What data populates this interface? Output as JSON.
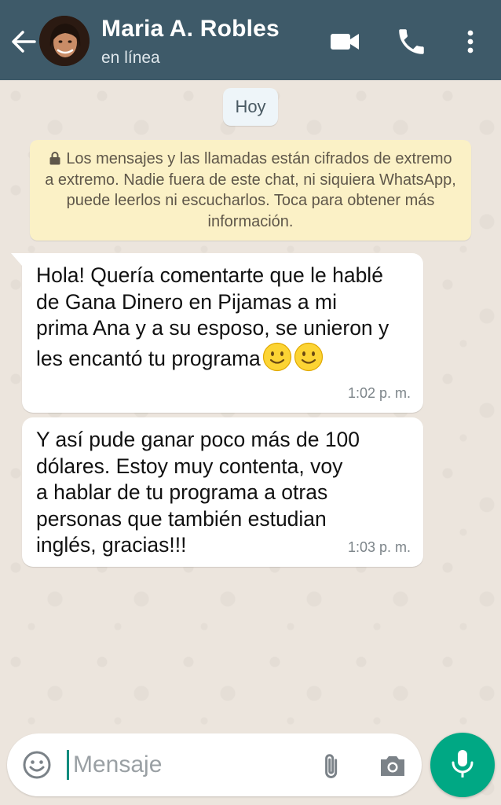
{
  "header": {
    "contact_name": "Maria A. Robles",
    "status": "en línea",
    "icons": {
      "back": "arrow-left-icon",
      "video": "video-camera-icon",
      "call": "phone-icon",
      "menu": "more-vert-icon"
    },
    "background_color": "#3e5a69"
  },
  "chat": {
    "date_chip": "Hoy",
    "encryption_notice": "Los mensajes y las llamadas están cifrados de extremo a extremo. Nadie fuera de este chat, ni siquiera WhatsApp, puede leerlos ni escucharlos. Toca para obtener más información.",
    "messages": [
      {
        "text": "Hola! Quería comentarte que le hablé\nde Gana Dinero en Pijamas a mi\nprima Ana y a su esposo, se unieron y\nles encantó tu programa",
        "emojis": [
          "smiling-face-emoji",
          "smiling-face-emoji"
        ],
        "time": "1:02 p. m."
      },
      {
        "text": "Y así pude ganar poco más de 100\ndólares. Estoy muy contenta, voy\na hablar de tu programa a otras\npersonas que también estudian\ninglés, gracias!!!",
        "time": "1:03 p. m."
      }
    ]
  },
  "composer": {
    "placeholder": "Mensaje",
    "value": "",
    "icons": {
      "emoji": "emoji-icon",
      "attach": "paperclip-icon",
      "camera": "camera-icon",
      "mic": "microphone-icon"
    },
    "accent_color": "#00a884"
  }
}
